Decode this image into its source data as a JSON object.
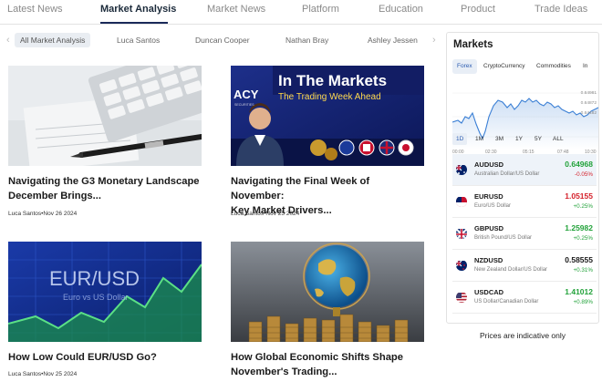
{
  "nav": {
    "tabs": [
      "Latest News",
      "Market Analysis",
      "Market News",
      "Platform",
      "Education",
      "Product",
      "Trade Ideas"
    ],
    "active": "Market Analysis"
  },
  "authors": {
    "items": [
      "All Market Analysis",
      "Luca Santos",
      "Duncan Cooper",
      "Nathan Bray",
      "Ashley Jessen"
    ],
    "active": "All Market Analysis"
  },
  "articles": [
    {
      "title_line1": "Navigating the G3 Monetary Landscape",
      "title_line2": "December Brings...",
      "author": "Luca Santos",
      "date": "Nov 26 2024",
      "image": "calculator-pen-documents"
    },
    {
      "title_line1": "Navigating the Final Week of November:",
      "title_line2": "Key Market Drivers...",
      "author": "Luca Santos",
      "date": "Nov 25 2024",
      "image": "in-the-markets-banner",
      "banner": {
        "brand": "ACY",
        "brand_sub": "SECURITIES",
        "headline": "In The Markets",
        "subline": "The Trading Week Ahead"
      }
    },
    {
      "title_line1": "How Low Could EUR/USD Go?",
      "title_line2": "",
      "author": "Luca Santos",
      "date": "Nov 25 2024",
      "image": "eur-usd-chart-screen",
      "screen": {
        "pair": "EUR/USD",
        "sub": "Euro vs US Dollar"
      }
    },
    {
      "title_line1": "How Global Economic Shifts Shape",
      "title_line2": "November's Trading...",
      "author": "",
      "date": "",
      "image": "globe-coins"
    }
  ],
  "markets": {
    "title": "Markets",
    "tabs": [
      "Forex",
      "CryptoCurrency",
      "Commodities",
      "In"
    ],
    "active_tab": "Forex",
    "chart": {
      "type": "line",
      "x_labels": [
        "00:00",
        "02:30",
        "05:15",
        "07:48",
        "10:30"
      ],
      "y_labels": [
        "0.64981",
        "0.64872",
        "0.64482"
      ],
      "line_color": "#3a7fd5"
    },
    "ranges": [
      "1D",
      "1M",
      "3M",
      "1Y",
      "5Y",
      "ALL"
    ],
    "active_range": "1D",
    "quotes": [
      {
        "symbol": "AUDUSD",
        "name": "Australian Dollar/US Dollar",
        "price": "0.64968",
        "change": "-0.05%",
        "price_dir": "up",
        "change_dir": "down",
        "flag": "au-flag"
      },
      {
        "symbol": "EURUSD",
        "name": "Euro/US Dollar",
        "price": "1.05155",
        "change": "+0.25%",
        "price_dir": "down",
        "change_dir": "up",
        "flag": "eu-flag"
      },
      {
        "symbol": "GBPUSD",
        "name": "British Pound/US Dollar",
        "price": "1.25982",
        "change": "+0.25%",
        "price_dir": "up",
        "change_dir": "up",
        "flag": "gb-flag"
      },
      {
        "symbol": "NZDUSD",
        "name": "New Zealand Dollar/US Dollar",
        "price": "0.58555",
        "change": "+0.31%",
        "price_dir": "neutral",
        "change_dir": "up",
        "flag": "nz-flag"
      },
      {
        "symbol": "USDCAD",
        "name": "US Dollar/Canadian Dollar",
        "price": "1.41012",
        "change": "+0.89%",
        "price_dir": "up",
        "change_dir": "up",
        "flag": "us-flag"
      }
    ],
    "disclaimer": "Prices are indicative only"
  },
  "colors": {
    "nav_active": "#1b2a3a",
    "up": "#22a23a",
    "down": "#d4202a",
    "accent_blue": "#2a5bb0"
  }
}
